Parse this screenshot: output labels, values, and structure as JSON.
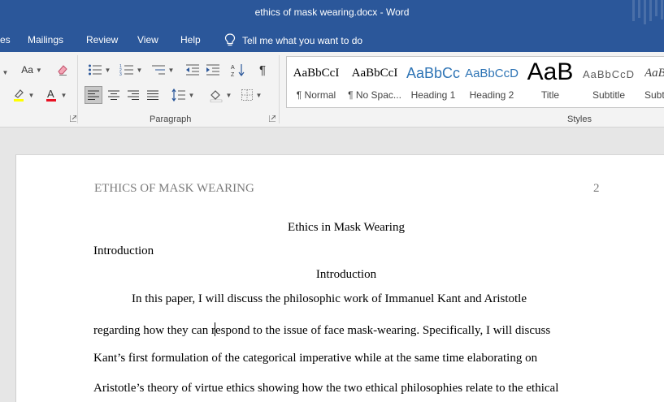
{
  "window": {
    "title": "ethics of mask wearing.docx  -  Word"
  },
  "tabs": [
    "es",
    "Mailings",
    "Review",
    "View",
    "Help"
  ],
  "tell_me": {
    "label": "Tell me what you want to do"
  },
  "ribbon": {
    "font_group": {
      "aa_label": "Aa"
    },
    "paragraph_group": {
      "label": "Paragraph",
      "pilcrow": "¶"
    },
    "styles_group": {
      "label": "Styles",
      "items": [
        {
          "sample": "AaBbCcI",
          "name": "¶ Normal"
        },
        {
          "sample": "AaBbCcI",
          "name": "¶ No Spac..."
        },
        {
          "sample": "AaBbCc",
          "name": "Heading 1"
        },
        {
          "sample": "AaBbCcD",
          "name": "Heading 2"
        },
        {
          "sample": "AaB",
          "name": "Title"
        },
        {
          "sample": "AaBbCcD",
          "name": "Subtitle"
        },
        {
          "sample": "AaBb",
          "name": "Subtl"
        }
      ]
    }
  },
  "document": {
    "header_left": "ETHICS OF MASK WEARING",
    "page_number": "2",
    "title": "Ethics in Mask Wearing",
    "heading_left": "Introduction",
    "heading_center": "Introduction",
    "lines": [
      "In this paper, I will discuss the philosophic work of Immanuel Kant and Aristotle",
      "regarding how they can respond to the issue of face mask-wearing. Specifically, I will discuss",
      "Kant’s first formulation of the categorical imperative while at the same time elaborating on",
      "Aristotle’s theory of virtue ethics showing how the two ethical philosophies relate to the ethical"
    ],
    "line2_before_cursor": "regarding how they can r",
    "line2_after_cursor": "espond to the issue of face mask-wearing. Specifically, I will discuss"
  },
  "colors": {
    "titlebar": "#2b579a",
    "ribbon": "#f3f3f3",
    "font_color_red": "#e81123",
    "highlight_yellow": "#ffff00"
  }
}
